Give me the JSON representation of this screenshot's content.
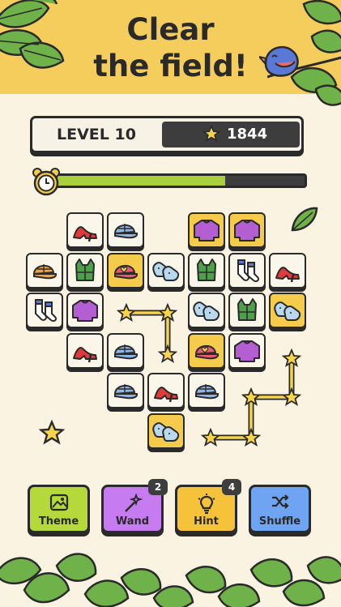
{
  "header": {
    "title_line1": "Clear",
    "title_line2": "the field!"
  },
  "level": {
    "label": "LEVEL 10",
    "score": "1844"
  },
  "timer": {
    "progress": 0.68
  },
  "board": {
    "tiles": [
      {
        "item": "shoe",
        "bg": "light"
      },
      {
        "item": "cap",
        "bg": "light"
      },
      {
        "item": "sweater",
        "bg": "gold"
      },
      {
        "item": "sweater",
        "bg": "gold"
      },
      {
        "item": "cap",
        "bg": "light"
      },
      {
        "item": "vest",
        "bg": "light"
      },
      {
        "item": "cap",
        "bg": "gold"
      },
      {
        "item": "mittens",
        "bg": "light"
      },
      {
        "item": "vest",
        "bg": "light"
      },
      {
        "item": "socks",
        "bg": "light"
      },
      {
        "item": "shoe",
        "bg": "light"
      },
      {
        "item": "socks",
        "bg": "light"
      },
      {
        "item": "sweater",
        "bg": "light"
      },
      {
        "item": "mittens",
        "bg": "light"
      },
      {
        "item": "vest",
        "bg": "light"
      },
      {
        "item": "mittens",
        "bg": "gold"
      },
      {
        "item": "shoe",
        "bg": "light"
      },
      {
        "item": "cap",
        "bg": "light"
      },
      {
        "item": "cap",
        "bg": "gold"
      },
      {
        "item": "sweater",
        "bg": "light"
      },
      {
        "item": "cap",
        "bg": "light"
      },
      {
        "item": "shoe",
        "bg": "light"
      },
      {
        "item": "cap",
        "bg": "light"
      },
      {
        "item": "mittens",
        "bg": "gold"
      }
    ]
  },
  "buttons": {
    "theme": {
      "label": "Theme",
      "color": "#b5d93a"
    },
    "wand": {
      "label": "Wand",
      "count": "2",
      "color": "#c77bf0"
    },
    "hint": {
      "label": "Hint",
      "count": "4",
      "color": "#f5c23a"
    },
    "shuffle": {
      "label": "Shuffle",
      "color": "#6fa4f2"
    }
  },
  "colors": {
    "banner": "#f4cd5d",
    "background": "#fbf3e2",
    "outline": "#2a2a2a",
    "star": "#f7d44a",
    "timer_fill": "#a9cf3c"
  }
}
